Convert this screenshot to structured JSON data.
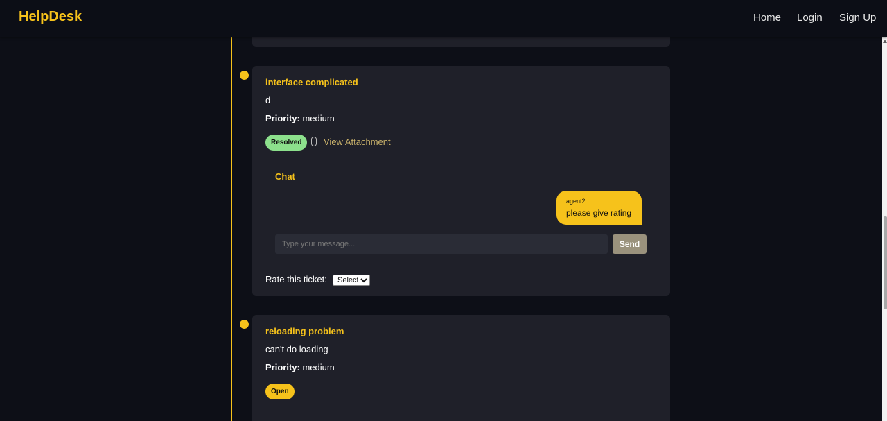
{
  "nav": {
    "brand": "HelpDesk",
    "links": [
      "Home",
      "Login",
      "Sign Up"
    ]
  },
  "tickets": [
    {
      "title": "interface complicated",
      "description": "d",
      "priority_label": "Priority:",
      "priority": "medium",
      "status": "Resolved",
      "attachment_label": "View Attachment",
      "chat": {
        "title": "Chat",
        "messages": [
          {
            "sender": "agent2",
            "text": "please give rating"
          }
        ],
        "input_placeholder": "Type your message...",
        "send_label": "Send"
      },
      "rate_label": "Rate this ticket:",
      "rate_selected": "Select"
    },
    {
      "title": "reloading problem",
      "description": "can't do loading",
      "priority_label": "Priority:",
      "priority": "medium",
      "status": "Open"
    }
  ],
  "colors": {
    "accent": "#f6c21b",
    "resolved": "#8ce08c",
    "card_bg": "#1f2029",
    "page_bg": "#0d0f17"
  }
}
